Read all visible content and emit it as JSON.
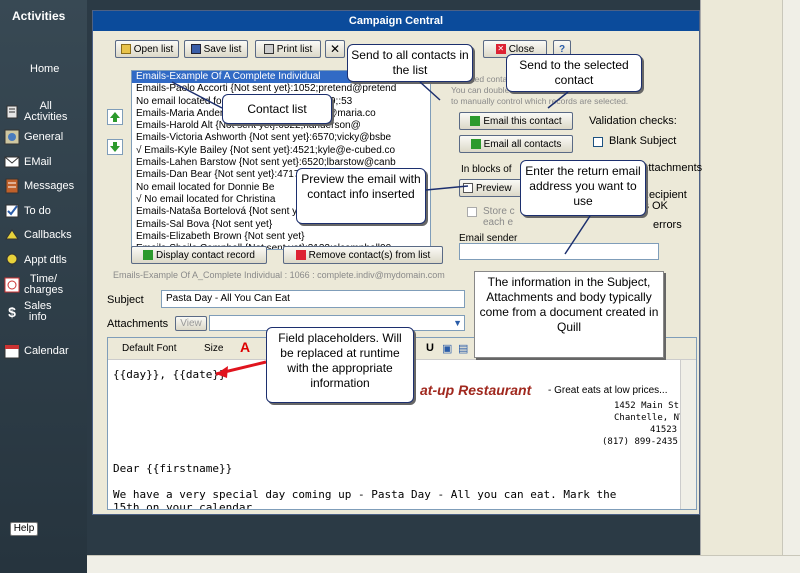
{
  "sidebar": {
    "title": "Activities",
    "items": [
      {
        "label": "Home",
        "icon": "home-icon"
      },
      {
        "label": "All\nActivities",
        "icon": "activities-icon"
      },
      {
        "label": "General",
        "icon": "general-icon"
      },
      {
        "label": "EMail",
        "icon": "email-icon"
      },
      {
        "label": "Messages",
        "icon": "messages-icon"
      },
      {
        "label": "To do",
        "icon": "todo-icon"
      },
      {
        "label": "Callbacks",
        "icon": "callbacks-icon"
      },
      {
        "label": "Appt dtls",
        "icon": "appointment-icon"
      },
      {
        "label": "Time/\ncharges",
        "icon": "time-charges-icon"
      },
      {
        "label": "Sales\ninfo",
        "icon": "sales-icon"
      },
      {
        "label": "Calendar",
        "icon": "calendar-icon"
      }
    ],
    "help": "Help"
  },
  "window": {
    "title": "Campaign Central",
    "toolbar": {
      "open_list": "Open list",
      "save_list": "Save list",
      "print_list": "Print list",
      "close": "Close"
    },
    "contacts": [
      "Emails-Example Of A  Complete Individual",
      "Emails-Paolo Accorti {Not sent yet}:1052;pretend@pretend",
      "No email located for Esq. {Not sent yet}:6579;:53",
      "Emails-Maria Anders {Not sent yet}:1;maria@maria.co",
      "Emails-Harold Alt {Not sent yet}:6522;handerson@",
      "Emails-Victoria Ashworth {Not sent yet}:6570;vicky@bsbe",
      "√ Emails-Kyle Bailey {Not sent yet}:4521;kyle@e-cubed.co",
      "Emails-Lahen Barstow {Not sent yet}:6520;lbarstow@canb",
      "Emails-Dan Bear {Not sent yet}:4717;pretend@pretending",
      "No email located for Donnie Be",
      "√ No email located for Christina",
      "Emails-Nataša Bortelová {Not sent yet}",
      "Emails-Sal Bova {Not sent yet}",
      "Emails-Elizabeth Brown {Not sent yet}",
      "Emails-Sheila Campbell {Not sent yet}:3122;slcampbell00"
    ],
    "display_contact_record": "Display contact record",
    "remove_contacts": "Remove contact(s) from list",
    "selected_detail": "Emails-Example Of A_Complete Individual : 1066 : complete.indiv@mydomain.com",
    "hint_line1": "Selected contacts are marked with a checkmark.",
    "hint_line2": "You can double-click",
    "hint_line3": "to manually control which records are selected.",
    "email_this_contact": "Email this contact",
    "email_all_contacts": "Email all contacts",
    "validation_checks": "Validation checks:",
    "blank_subject": "Blank Subject",
    "attachments_check": "Attachments",
    "check_recipient": "Recipient",
    "check_is_ok": "is OK",
    "check_errors": "errors",
    "in_blocks_of": "In blocks of",
    "preview": "Preview",
    "store_copy": "Store c",
    "each_email": "each e",
    "email_sender_label": "Email sender",
    "email_sender_value": "",
    "subject_label": "Subject",
    "subject_value": "Pasta Day - All You Can Eat",
    "attachments_label": "Attachments",
    "view_button": "View",
    "editor": {
      "font": "Default Font",
      "size": "Size",
      "placeholder_line": "{{day}}, {{date}}",
      "restaurant_name": "at-up Restaurant",
      "tagline": " - Great eats at low prices...",
      "address1": "1452 Main St.",
      "address2": "Chantelle, NY",
      "zip": "41523",
      "phone": "(817) 899-2435",
      "greeting": "Dear {{firstname}}",
      "body": "We have a very special day coming up - Pasta Day - All you can eat. Mark the 15th on your calendar."
    }
  },
  "callouts": {
    "send_all": "Send to all contacts in the list",
    "send_selected": "Send to the selected contact",
    "contact_list": "Contact list",
    "preview": "Preview the email with contact info inserted",
    "return_address": "Enter the return email address you want to use",
    "information": "The information in the Subject, Attachments and body typically come from a document created in              Quill",
    "placeholders": "Field placeholders. Will be replaced at runtime with the appropriate information"
  },
  "colors": {
    "titlebar": "#0b4b9b",
    "sidebar": "#2b3a45",
    "selection": "#316ac5",
    "restaurant": "#a0281e",
    "arrow": "#e0141e"
  }
}
